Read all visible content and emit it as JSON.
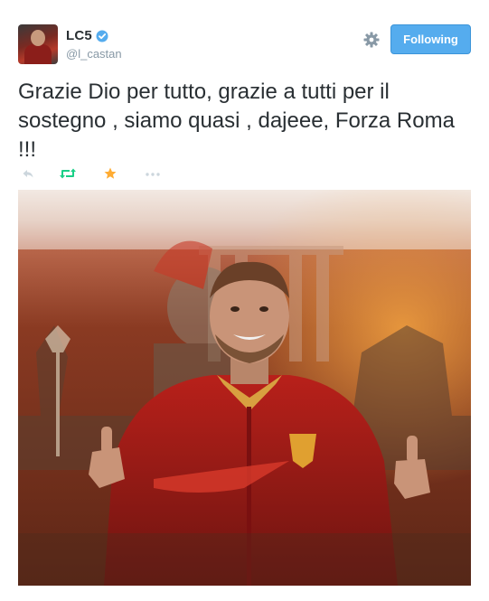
{
  "user": {
    "display_name": "LC5",
    "handle": "@l_castan",
    "verified": true
  },
  "follow_button": {
    "label": "Following"
  },
  "tweet": {
    "text": "Grazie Dio per tutto, grazie a tutti per il sostegno , siamo quasi , dajeee, Forza Roma !!!"
  },
  "actions": [
    "reply-icon",
    "retweet-icon",
    "favorite-icon",
    "more-icon"
  ],
  "colors": {
    "follow_bg": "#55acee",
    "retweet_active": "#19cf86",
    "favorite_active": "#ffac33",
    "icon_gray": "#ccd6dd",
    "text": "#292f33",
    "muted": "#8899a6"
  }
}
